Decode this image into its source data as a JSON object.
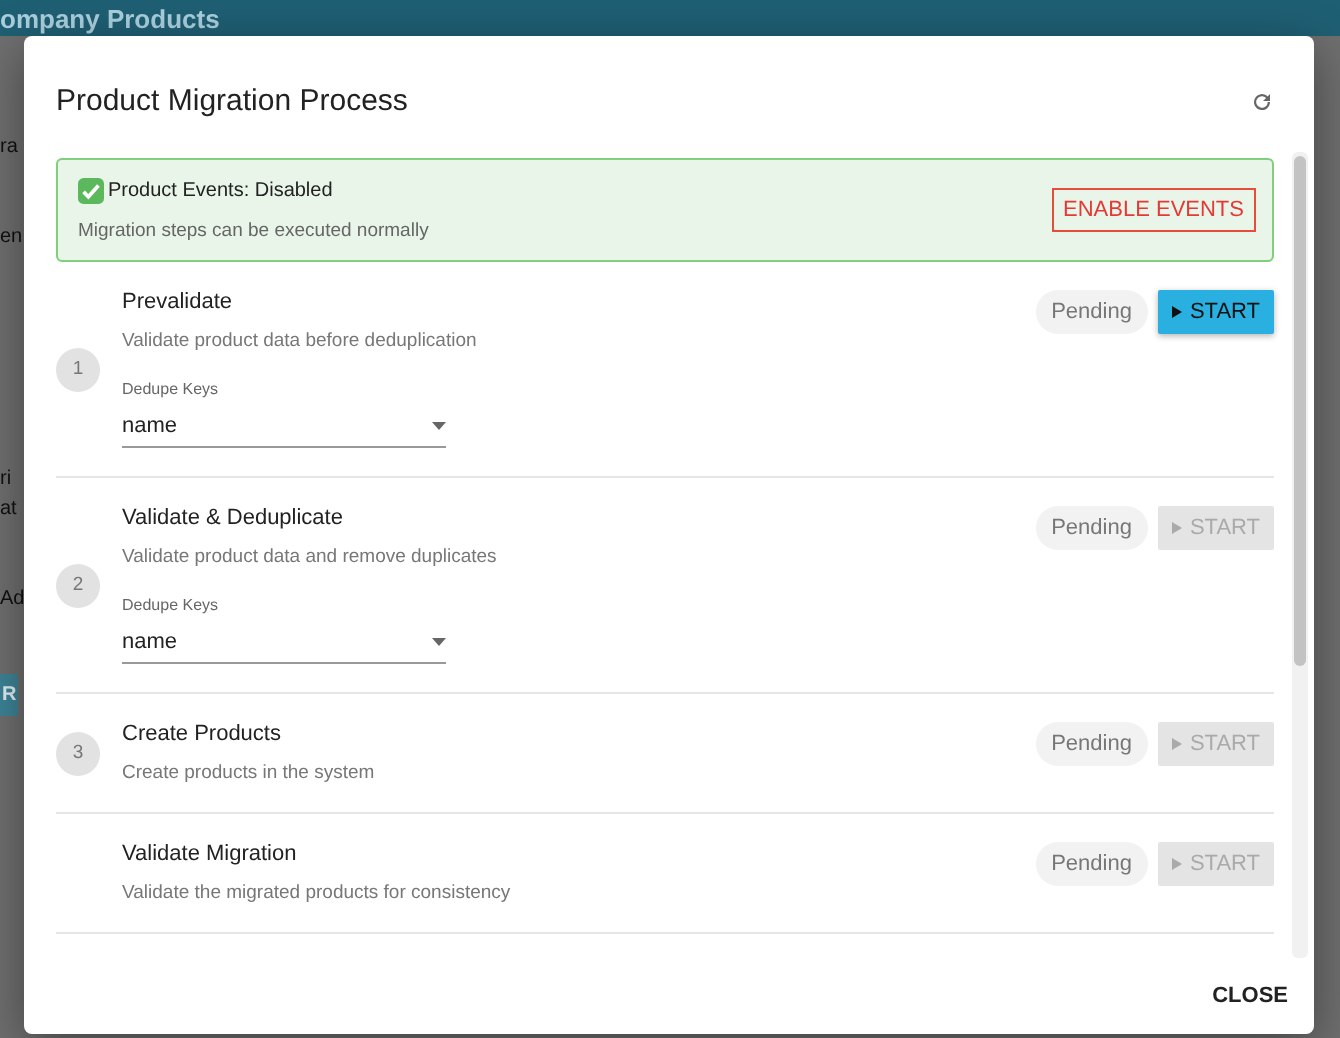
{
  "page": {
    "title": "ompany Products",
    "fragments": [
      {
        "text": "ra",
        "kind": "text"
      },
      {
        "text": "en",
        "kind": "text"
      },
      {
        "text": "ri",
        "kind": "text"
      },
      {
        "text": "at",
        "kind": "text"
      },
      {
        "text": "Ad",
        "kind": "text"
      },
      {
        "text": "R",
        "kind": "button"
      }
    ]
  },
  "dialog": {
    "title": "Product Migration Process",
    "banner": {
      "title": "Product Events: Disabled",
      "message": "Migration steps can be executed normally",
      "action": "ENABLE EVENTS"
    },
    "steps": [
      {
        "number": "1",
        "title": "Prevalidate",
        "description": "Validate product data before deduplication",
        "field": {
          "label": "Dedupe Keys",
          "value": "name"
        },
        "status": "Pending",
        "button": "START",
        "disabled": false
      },
      {
        "number": "2",
        "title": "Validate & Deduplicate",
        "description": "Validate product data and remove duplicates",
        "field": {
          "label": "Dedupe Keys",
          "value": "name"
        },
        "status": "Pending",
        "button": "START",
        "disabled": true
      },
      {
        "number": "3",
        "title": "Create Products",
        "description": "Create products in the system",
        "status": "Pending",
        "button": "START",
        "disabled": true
      },
      {
        "title": "Validate Migration",
        "description": "Validate the migrated products for consistency",
        "status": "Pending",
        "button": "START",
        "disabled": true
      }
    ],
    "close": "CLOSE"
  }
}
